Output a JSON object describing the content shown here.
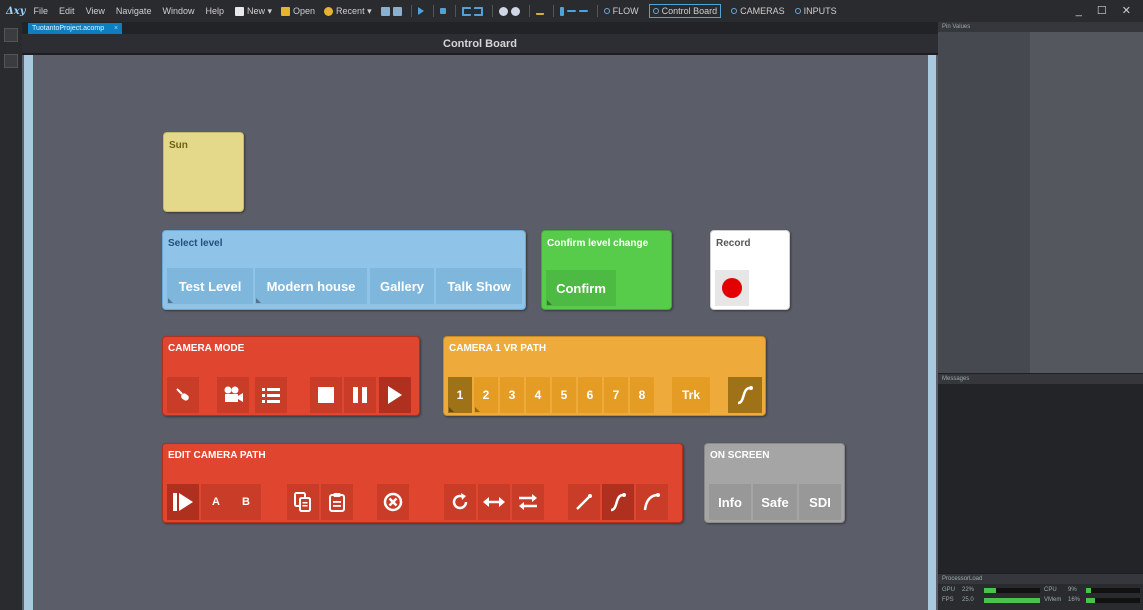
{
  "menubar": {
    "logo": "Δxy",
    "menus": [
      "File",
      "Edit",
      "View",
      "Navigate",
      "Window",
      "Help"
    ],
    "new_label": "New ▾",
    "open_label": "Open",
    "recent_label": "Recent ▾",
    "modes": [
      "FLOW",
      "Control Board",
      "CAMERAS",
      "INPUTS"
    ],
    "window_controls": "_ ☐ ✕"
  },
  "tabs": {
    "file_tab": "TuotantoProject.acomp",
    "close_glyph": "×"
  },
  "canvas": {
    "title": "Control Board"
  },
  "widgets": {
    "sun": {
      "title": "Sun"
    },
    "select_level": {
      "title": "Select level",
      "buttons": [
        "Test Level",
        "Modern house",
        "Gallery",
        "Talk Show"
      ]
    },
    "confirm": {
      "title": "Confirm level change",
      "button": "Confirm"
    },
    "record": {
      "title": "Record"
    },
    "camera_mode": {
      "title": "CAMERA MODE"
    },
    "vr_path": {
      "title": "CAMERA 1 VR PATH",
      "buttons": [
        "1",
        "2",
        "3",
        "4",
        "5",
        "6",
        "7",
        "8"
      ],
      "trk": "Trk"
    },
    "edit_path": {
      "title": "EDIT CAMERA PATH",
      "a": "A",
      "b": "B"
    },
    "on_screen": {
      "title": "ON SCREEN",
      "buttons": [
        "Info",
        "Safe",
        "SDI"
      ]
    }
  },
  "panels": {
    "pin_values": "Pin Values",
    "messages": "Messages",
    "processor_load": "ProcessorLoad",
    "gpu_label": "GPU",
    "gpu_value": "22%",
    "gpu_fraction": 0.22,
    "fps_label": "FPS",
    "fps_value": "25.0",
    "fps_fraction": 1.0,
    "cpu_label": "CPU",
    "cpu_value": "9%",
    "cpu_fraction": 0.09,
    "vmem_label": "VMem",
    "vmem_value": "16%",
    "vmem_fraction": 0.16
  },
  "colors": {
    "accent": "#0d7fc0",
    "record_dot": "#e30000",
    "camera_red": "#e04530",
    "vr_orange": "#eeaa3a",
    "confirm_green": "#57cc4b",
    "level_blue": "#8fc4e8"
  }
}
